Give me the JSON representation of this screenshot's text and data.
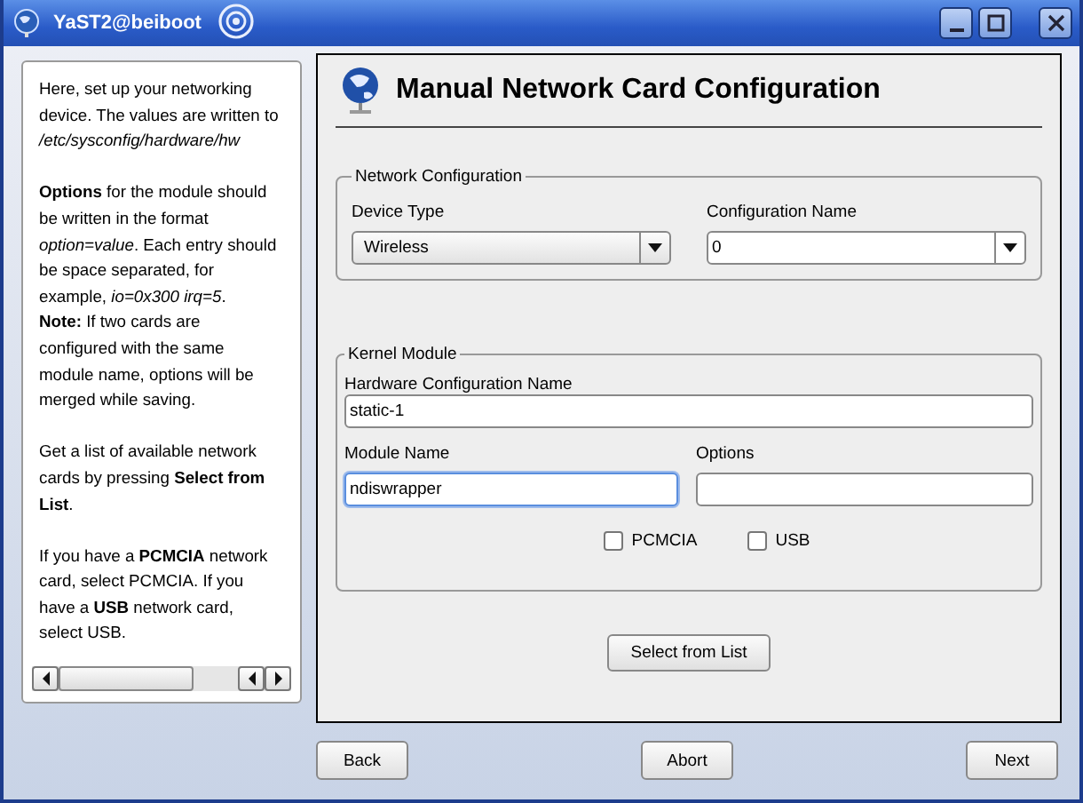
{
  "window": {
    "title": "YaST2@beiboot"
  },
  "help": [
    {
      "sentences": [
        "Here, set up your networking device. The values are written to */etc/sysconfig/hardware/hw*"
      ]
    },
    {
      "sentences": [
        "**Options** for the module should be written in the format *option=value*. Each entry should be space separated, for example, *io=0x300 irq=5*.",
        "**Note:** If two cards are configured with the same module name, options will be merged while saving."
      ]
    },
    {
      "sentences": [
        "Get a list of available network cards by pressing **Select from List**."
      ]
    },
    {
      "sentences": [
        "If you have a **PCMCIA** network card, select PCMCIA. If you have a **USB** network card, select USB."
      ]
    }
  ],
  "heading": "Manual Network Card Configuration",
  "network_configuration": {
    "title": "Network Configuration",
    "device_type": {
      "label": "Device Type",
      "value": "Wireless",
      "editable": false
    },
    "configuration_name": {
      "label": "Configuration Name",
      "value": "0",
      "editable": true
    }
  },
  "kernel_module": {
    "title": "Kernel Module",
    "hardware_configuration_name": {
      "label": "Hardware Configuration Name",
      "value": "static-1",
      "focused": false
    },
    "module_name": {
      "label": "Module Name",
      "value": "ndiswrapper",
      "focused": true
    },
    "options": {
      "label": "Options",
      "focused": false
    },
    "checkboxes": [
      {
        "label": "PCMCIA",
        "checked": false
      },
      {
        "label": "USB",
        "checked": false
      }
    ]
  },
  "select_button": "Select from List",
  "buttons": [
    {
      "label": "Back"
    },
    {
      "label": "Abort"
    },
    {
      "label": "Next"
    }
  ]
}
